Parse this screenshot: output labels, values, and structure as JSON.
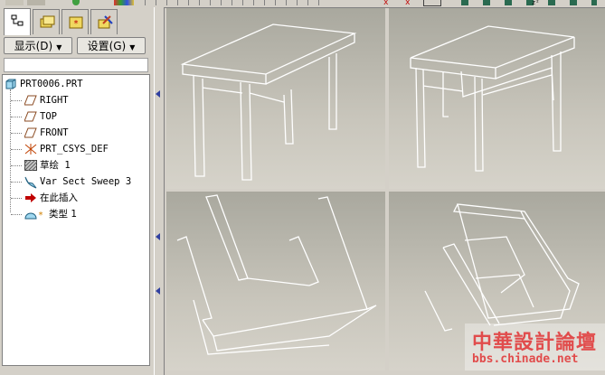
{
  "toolbar": {
    "icons": [
      "pencil-icon",
      "eraser-icon",
      "circle-icon",
      "palette-icon",
      "ruler-icon",
      "close-icon",
      "delete-icon",
      "view-icon",
      "eye-icon",
      "coordinate-icon"
    ]
  },
  "tabs": [
    {
      "id": "model-tree",
      "icon": "tree-icon",
      "active": true
    },
    {
      "id": "folder-browser",
      "icon": "folder-icon",
      "active": false
    },
    {
      "id": "favorites",
      "icon": "favorites-icon",
      "active": false
    },
    {
      "id": "connections",
      "icon": "connections-icon",
      "active": false
    }
  ],
  "menus": {
    "display": "显示(D)",
    "settings": "设置(G)"
  },
  "tree": {
    "root": "PRT0006.PRT",
    "items": [
      {
        "label": "RIGHT",
        "icon": "datum-plane-icon"
      },
      {
        "label": "TOP",
        "icon": "datum-plane-icon"
      },
      {
        "label": "FRONT",
        "icon": "datum-plane-icon"
      },
      {
        "label": "PRT_CSYS_DEF",
        "icon": "csys-icon"
      },
      {
        "label": "草绘 1",
        "icon": "sketch-icon"
      },
      {
        "label": "Var Sect Sweep 3",
        "icon": "sweep-icon"
      },
      {
        "label": "在此插入",
        "icon": "insert-arrow-icon"
      },
      {
        "label": "类型 1",
        "icon": "type-feature-icon"
      }
    ]
  },
  "watermark": {
    "title": "中華設計論壇",
    "url": "bbs.chinade.net"
  },
  "colors": {
    "accent": "#3040a0",
    "watermark": "#e14c4c",
    "insert_arrow": "#c00000"
  }
}
